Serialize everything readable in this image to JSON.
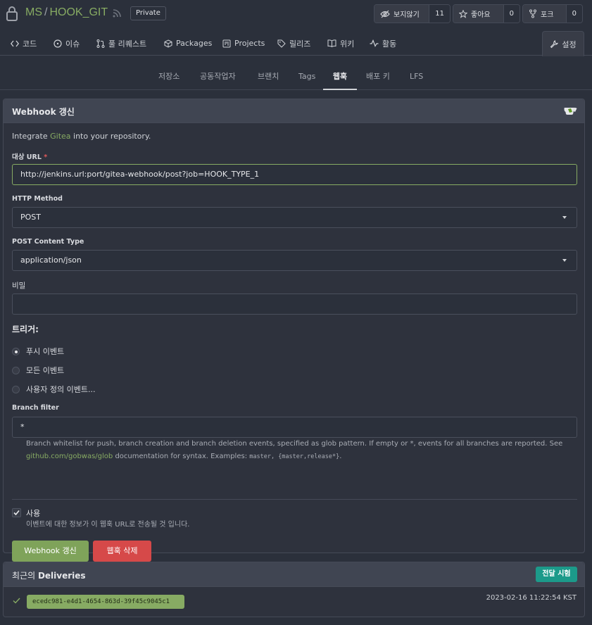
{
  "repo": {
    "owner": "MS",
    "separator": "/",
    "name": "HOOK_GIT",
    "visibility": "Private"
  },
  "actions": {
    "watch": {
      "label": "보지않기",
      "count": "11"
    },
    "star": {
      "label": "좋아요",
      "count": "0"
    },
    "fork": {
      "label": "포크",
      "count": "0"
    }
  },
  "tabs": [
    "코드",
    "이슈",
    "풀 리퀘스트",
    "Packages",
    "Projects",
    "릴리즈",
    "위키",
    "활동",
    "설정"
  ],
  "settings_tabs": [
    "저장소",
    "공동작업자",
    "브랜치",
    "Tags",
    "웹훅",
    "배포 키",
    "LFS"
  ],
  "form": {
    "title": "Webhook 갱신",
    "intro_prefix": "Integrate ",
    "intro_link": "Gitea",
    "intro_suffix": " into your repository.",
    "target_url_label": "대상 URL",
    "required_mark": "*",
    "target_url": "http://jenkins.url:port/gitea-webhook/post?job=HOOK_TYPE_1",
    "http_method_label": "HTTP Method",
    "http_method": "POST",
    "content_type_label": "POST Content Type",
    "content_type": "application/json",
    "secret_label": "비밀",
    "secret": "",
    "trigger_label": "트리거:",
    "triggers": [
      "푸시 이벤트",
      "모든 이벤트",
      "사용자 정의 이벤트..."
    ],
    "branch_filter_label": "Branch filter",
    "branch_filter": "*",
    "help_text_1": "Branch whitelist for push, branch creation and branch deletion events, specified as glob pattern. If empty or *, events for all branches are reported. See",
    "help_link": "github.com/gobwas/glob",
    "help_text_2": " documentation for syntax. Examples: ",
    "help_code": "master, {master,release*}",
    "help_end": ".",
    "active_label": "사용",
    "active_desc": "이벤트에 대한 정보가 이 웹훅 URL로 전송될 것 입니다.",
    "update_button": "Webhook 갱신",
    "delete_button": "웹훅 삭제"
  },
  "deliveries": {
    "title_prefix": "최근의 ",
    "title_bold": "Deliveries",
    "test_button": "전달 시험",
    "items": [
      {
        "id": "ecedc981-e4d1-4654-863d-39f45c9045c1",
        "time": "2023-02-16 11:22:54 KST"
      }
    ]
  },
  "colors": {
    "accent": "#87ab63",
    "danger": "#d64949",
    "teal": "#1c9a8a",
    "page_bg": "#2b303b"
  }
}
